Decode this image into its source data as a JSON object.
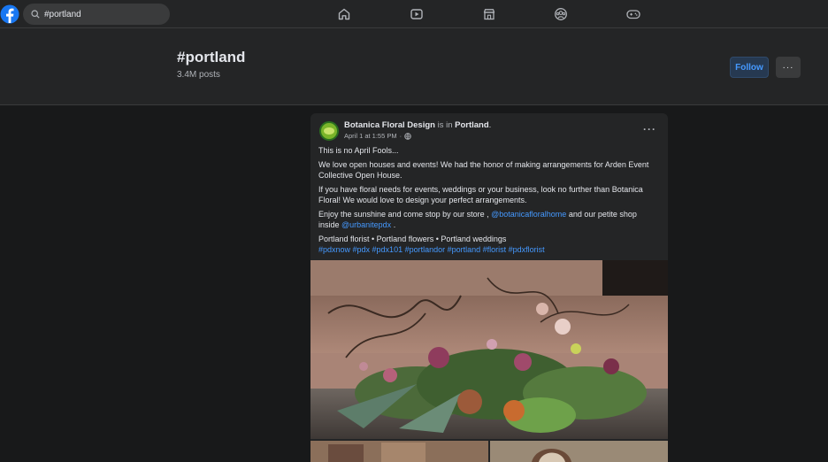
{
  "search": {
    "value": "#portland"
  },
  "header": {
    "hashtag": "#portland",
    "post_count": "3.4M posts",
    "follow_label": "Follow",
    "more_label": "···"
  },
  "post": {
    "author": "Botanica Floral Design",
    "is_in": "is in",
    "location": "Portland",
    "location_suffix": ".",
    "date": "April 1 at 1:55 PM",
    "date_sep": "·",
    "menu_label": "···",
    "paragraphs": {
      "p1": "This is no April Fools...",
      "p2": "We love open houses and events!  We had the honor of making arrangements for Arden Event Collective Open House.",
      "p3": "If you have floral needs for events, weddings or your business, look no further than Botanica Floral! We would love to design your perfect arrangements.",
      "p4_a": "Enjoy the sunshine and come stop by our store , ",
      "p4_link1": "@botanicafloralhome",
      "p4_b": " and our petite shop inside ",
      "p4_link2": "@urbanitepdx",
      "p4_c": " .",
      "p5": "Portland florist • Portland flowers • Portland weddings",
      "hashtags": "#pdxnow #pdx #pdx101 #portlandor #portland #florist #pdxflorist"
    }
  },
  "colors": {
    "background": "#18191a",
    "surface": "#242526",
    "accent": "#4599ff",
    "fb_blue": "#1877f2"
  }
}
